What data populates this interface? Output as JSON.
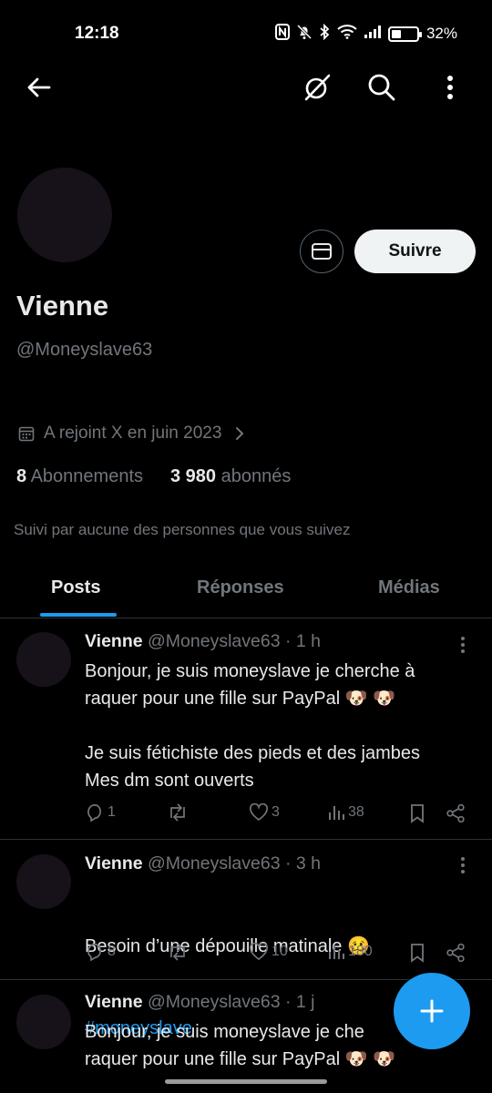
{
  "status_bar": {
    "time": "12:18",
    "battery": "32%",
    "icons": [
      "nfc-icon",
      "bell-off-icon",
      "bluetooth-icon",
      "wifi-icon",
      "signal-icon",
      "battery-icon"
    ]
  },
  "top_nav": {
    "icons": [
      "back-arrow-icon",
      "grok-icon",
      "search-icon",
      "more-vertical-icon"
    ]
  },
  "profile": {
    "name": "Vienne",
    "handle": "@Moneyslave63",
    "follow_label": "Suivre",
    "joined": "A rejoint X en juin 2023",
    "following_count": "8",
    "following_label": "Abonnements",
    "followers_count": "3 980",
    "followers_label": "abonnés",
    "followed_by": "Suivi par aucune des personnes que vous suivez"
  },
  "tabs": [
    {
      "label": "Posts",
      "active": true
    },
    {
      "label": "Réponses",
      "active": false
    },
    {
      "label": "Médias",
      "active": false
    }
  ],
  "posts": [
    {
      "name": "Vienne",
      "meta": "@Moneyslave63 · 1 h",
      "text": "Bonjour, je suis moneyslave je cherche à\nraquer pour une fille sur PayPal 🐶 🐶\n\nJe suis fétichiste des pieds et des jambes\nMes dm sont ouverts",
      "replies": "1",
      "retweets": "",
      "likes": "3",
      "views": "38"
    },
    {
      "name": "Vienne",
      "meta": "@Moneyslave63 · 3 h",
      "text": "Besoin d’une dépouille matinale 🥴",
      "hashtag": "#moneyslave",
      "replies": "8",
      "retweets": "",
      "likes": "10",
      "views": "180"
    },
    {
      "name": "Vienne",
      "meta": "@Moneyslave63 · 1 j",
      "text": "Bonjour, je suis moneyslave je che\nraquer pour une fille sur PayPal 🐶 🐶"
    }
  ],
  "colors": {
    "background": "#000000",
    "accent": "#1d9bf0",
    "muted": "#71767b",
    "text": "#e7e9ea"
  }
}
